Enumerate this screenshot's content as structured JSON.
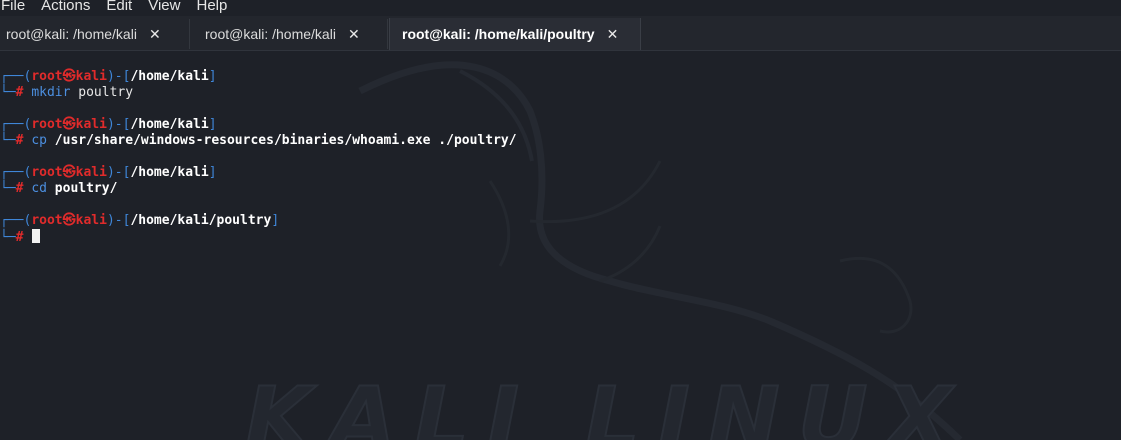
{
  "menu": [
    "File",
    "Actions",
    "Edit",
    "View",
    "Help"
  ],
  "tabs": [
    {
      "title": "root@kali: /home/kali",
      "close": "✕"
    },
    {
      "title": "root@kali: /home/kali",
      "close": "✕"
    },
    {
      "title": "root@kali: /home/kali/poultry",
      "close": "✕"
    }
  ],
  "prompt": {
    "user": "root",
    "host": "kali",
    "symbol": "㉿",
    "hash": "#"
  },
  "blocks": [
    {
      "path": "/home/kali",
      "cmd": "mkdir",
      "args": "poultry",
      "args_bold": false
    },
    {
      "path": "/home/kali",
      "cmd": "cp",
      "args": "/usr/share/windows-resources/binaries/whoami.exe ./poultry/",
      "args_bold": true
    },
    {
      "path": "/home/kali",
      "cmd": "cd",
      "args": "poultry/",
      "args_bold": true
    },
    {
      "path": "/home/kali/poultry",
      "cmd": "",
      "args": "",
      "args_bold": false
    }
  ],
  "watermark": "KALI LINUX",
  "colors": {
    "background": "#1e2128",
    "prompt_red": "#e02b2b",
    "prompt_blue": "#3f86d8"
  }
}
